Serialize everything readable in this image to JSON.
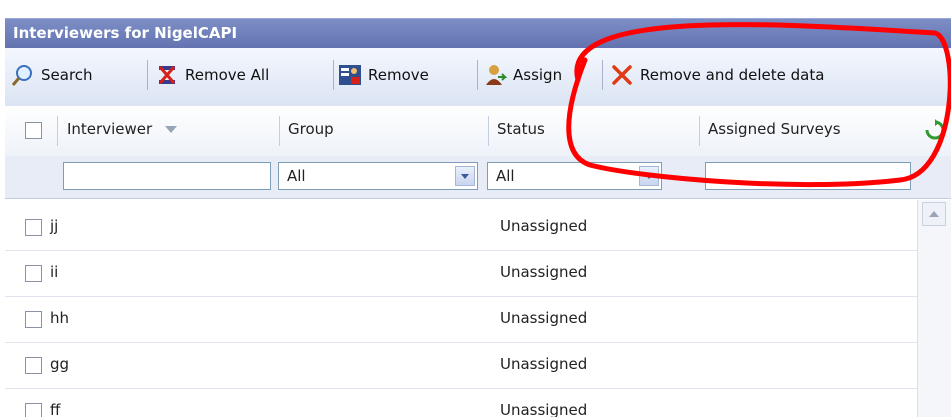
{
  "window": {
    "title": "Interviewers for NigelCAPI"
  },
  "toolbar": {
    "search_label": "Search",
    "remove_all_label": "Remove All",
    "remove_label": "Remove",
    "assign_label": "Assign",
    "remove_delete_label": "Remove and delete data"
  },
  "columns": {
    "interviewer": "Interviewer",
    "group": "Group",
    "status": "Status",
    "assigned_surveys": "Assigned Surveys"
  },
  "filters": {
    "interviewer_value": "",
    "group_value": "All",
    "status_value": "All",
    "assigned_value": ""
  },
  "rows": [
    {
      "name": "jj",
      "status": "Unassigned"
    },
    {
      "name": "ii",
      "status": "Unassigned"
    },
    {
      "name": "hh",
      "status": "Unassigned"
    },
    {
      "name": "gg",
      "status": "Unassigned"
    },
    {
      "name": "ff",
      "status": "Unassigned"
    }
  ],
  "icons": {
    "search": "magnifier-icon",
    "remove_all": "remove-all-icon",
    "remove": "remove-user-icon",
    "assign": "assign-user-icon",
    "remove_delete": "red-x-icon",
    "sort": "sort-down-icon",
    "refresh": "refresh-icon"
  },
  "colors": {
    "title_bar": "#6979b8",
    "annotation": "#ff0000",
    "delete_x": "#e03b16"
  }
}
